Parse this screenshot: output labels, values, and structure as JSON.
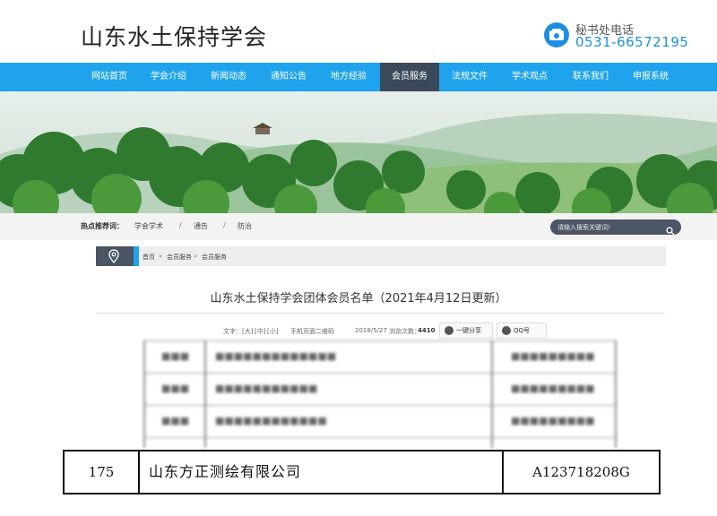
{
  "header": {
    "site_title": "山东水土保持学会",
    "phone_label": "秘书处电话",
    "phone_number": "0531-66572195",
    "accent_color": "#1ea3ec"
  },
  "nav": {
    "items": [
      {
        "label": "网站首页"
      },
      {
        "label": "学会介绍"
      },
      {
        "label": "新闻动态"
      },
      {
        "label": "通知公告"
      },
      {
        "label": "地方经验"
      },
      {
        "label": "会员服务",
        "active": true
      },
      {
        "label": "法规文件"
      },
      {
        "label": "学术观点"
      },
      {
        "label": "联系我们"
      },
      {
        "label": "申报系统"
      }
    ]
  },
  "hotbar": {
    "label": "热点推荐词：",
    "links": [
      "学会学术",
      "通告",
      "防治"
    ],
    "separator": "/",
    "search_placeholder": "请输入搜索关键词!"
  },
  "breadcrumb": {
    "items": [
      "首页",
      "会员服务",
      "会员服务"
    ],
    "separator": "»"
  },
  "article": {
    "title": "山东水土保持学会团体会员名单（2021年4月12日更新）",
    "meta_text_label": "文字：",
    "font_sizes": [
      "[大]",
      "[中]",
      "[小]"
    ],
    "qr_label": "手机页面二维码",
    "date": "2018/5/27",
    "views_label": "浏览次数：",
    "views": "4410",
    "share_label": "一键分享",
    "qq_label": "QQ号"
  },
  "member_table": {
    "rows": [
      {
        "no": "175",
        "name": "山东方正测绘有限公司",
        "code": "A123718208G"
      }
    ]
  }
}
